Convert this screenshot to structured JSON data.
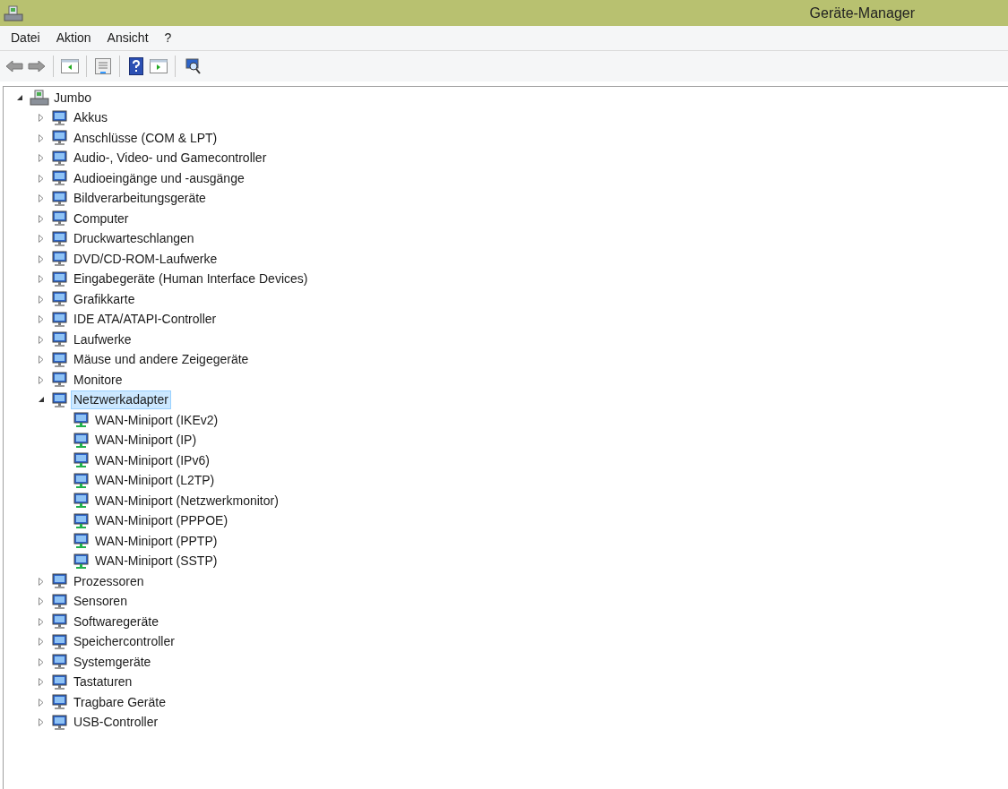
{
  "window": {
    "title": "Geräte-Manager"
  },
  "menu": [
    "Datei",
    "Aktion",
    "Ansicht",
    "?"
  ],
  "tree": [
    {
      "label": "Jumbo",
      "expanded": true,
      "selected": false,
      "children": [
        {
          "label": "Akkus",
          "expanded": false,
          "selected": false
        },
        {
          "label": "Anschlüsse (COM & LPT)",
          "expanded": false,
          "selected": false
        },
        {
          "label": "Audio-, Video- und Gamecontroller",
          "expanded": false,
          "selected": false
        },
        {
          "label": "Audioeingänge und -ausgänge",
          "expanded": false,
          "selected": false
        },
        {
          "label": "Bildverarbeitungsgeräte",
          "expanded": false,
          "selected": false
        },
        {
          "label": "Computer",
          "expanded": false,
          "selected": false
        },
        {
          "label": "Druckwarteschlangen",
          "expanded": false,
          "selected": false
        },
        {
          "label": "DVD/CD-ROM-Laufwerke",
          "expanded": false,
          "selected": false
        },
        {
          "label": "Eingabegeräte (Human Interface Devices)",
          "expanded": false,
          "selected": false
        },
        {
          "label": "Grafikkarte",
          "expanded": false,
          "selected": false
        },
        {
          "label": "IDE ATA/ATAPI-Controller",
          "expanded": false,
          "selected": false
        },
        {
          "label": "Laufwerke",
          "expanded": false,
          "selected": false
        },
        {
          "label": "Mäuse und andere Zeigegeräte",
          "expanded": false,
          "selected": false
        },
        {
          "label": "Monitore",
          "expanded": false,
          "selected": false
        },
        {
          "label": "Netzwerkadapter",
          "expanded": true,
          "selected": true,
          "children": [
            {
              "label": "WAN-Miniport (IKEv2)",
              "selected": false
            },
            {
              "label": "WAN-Miniport (IP)",
              "selected": false
            },
            {
              "label": "WAN-Miniport (IPv6)",
              "selected": false
            },
            {
              "label": "WAN-Miniport (L2TP)",
              "selected": false
            },
            {
              "label": "WAN-Miniport (Netzwerkmonitor)",
              "selected": false
            },
            {
              "label": "WAN-Miniport (PPPOE)",
              "selected": false
            },
            {
              "label": "WAN-Miniport (PPTP)",
              "selected": false
            },
            {
              "label": "WAN-Miniport (SSTP)",
              "selected": false
            }
          ]
        },
        {
          "label": "Prozessoren",
          "expanded": false,
          "selected": false
        },
        {
          "label": "Sensoren",
          "expanded": false,
          "selected": false
        },
        {
          "label": "Softwaregeräte",
          "expanded": false,
          "selected": false
        },
        {
          "label": "Speichercontroller",
          "expanded": false,
          "selected": false
        },
        {
          "label": "Systemgeräte",
          "expanded": false,
          "selected": false
        },
        {
          "label": "Tastaturen",
          "expanded": false,
          "selected": false
        },
        {
          "label": "Tragbare Geräte",
          "expanded": false,
          "selected": false
        },
        {
          "label": "USB-Controller",
          "expanded": false,
          "selected": false
        }
      ]
    }
  ]
}
